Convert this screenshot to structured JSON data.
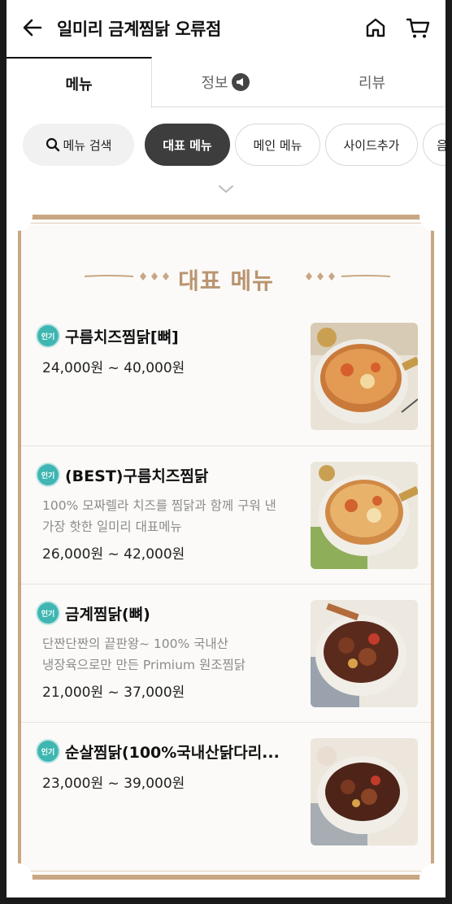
{
  "header": {
    "store_name": "일미리 금계찜닭 오류점"
  },
  "tabs": [
    {
      "label": "메뉴",
      "active": true
    },
    {
      "label": "정보",
      "active": false
    },
    {
      "label": "리뷰",
      "active": false
    }
  ],
  "chips": {
    "search_label": "메뉴 검색",
    "items": [
      "대표 메뉴",
      "메인 메뉴",
      "사이드추가",
      "음"
    ],
    "selected": "대표 메뉴"
  },
  "section": {
    "title": "대표 메뉴"
  },
  "menu_items": [
    {
      "badge": "인기",
      "name": "구름치즈찜닭[뼈]",
      "desc_line1": "",
      "desc_line2": "",
      "price": "24,000원 ~ 40,000원"
    },
    {
      "badge": "인기",
      "name": "(BEST)구름치즈찜닭",
      "desc_line1": "100% 모짜렐라 치즈를 찜닭과 함께 구워 낸",
      "desc_line2": "가장 핫한 일미리 대표메뉴",
      "price": "26,000원 ~ 42,000원"
    },
    {
      "badge": "인기",
      "name": "금계찜닭(뼈)",
      "desc_line1": "단짠단짠의 끝판왕~ 100% 국내산",
      "desc_line2": "냉장육으로만 만든 Primium 원조찜닭",
      "price": "21,000원 ~ 37,000원"
    },
    {
      "badge": "인기",
      "name": "순살찜닭(100%국내산닭다리...",
      "desc_line1": "",
      "desc_line2": "",
      "price": "23,000원 ~ 39,000원"
    }
  ],
  "colors": {
    "accent_gold": "#b9956f",
    "badge_teal": "#3fb6b1",
    "chip_selected": "#3d3d3d"
  }
}
